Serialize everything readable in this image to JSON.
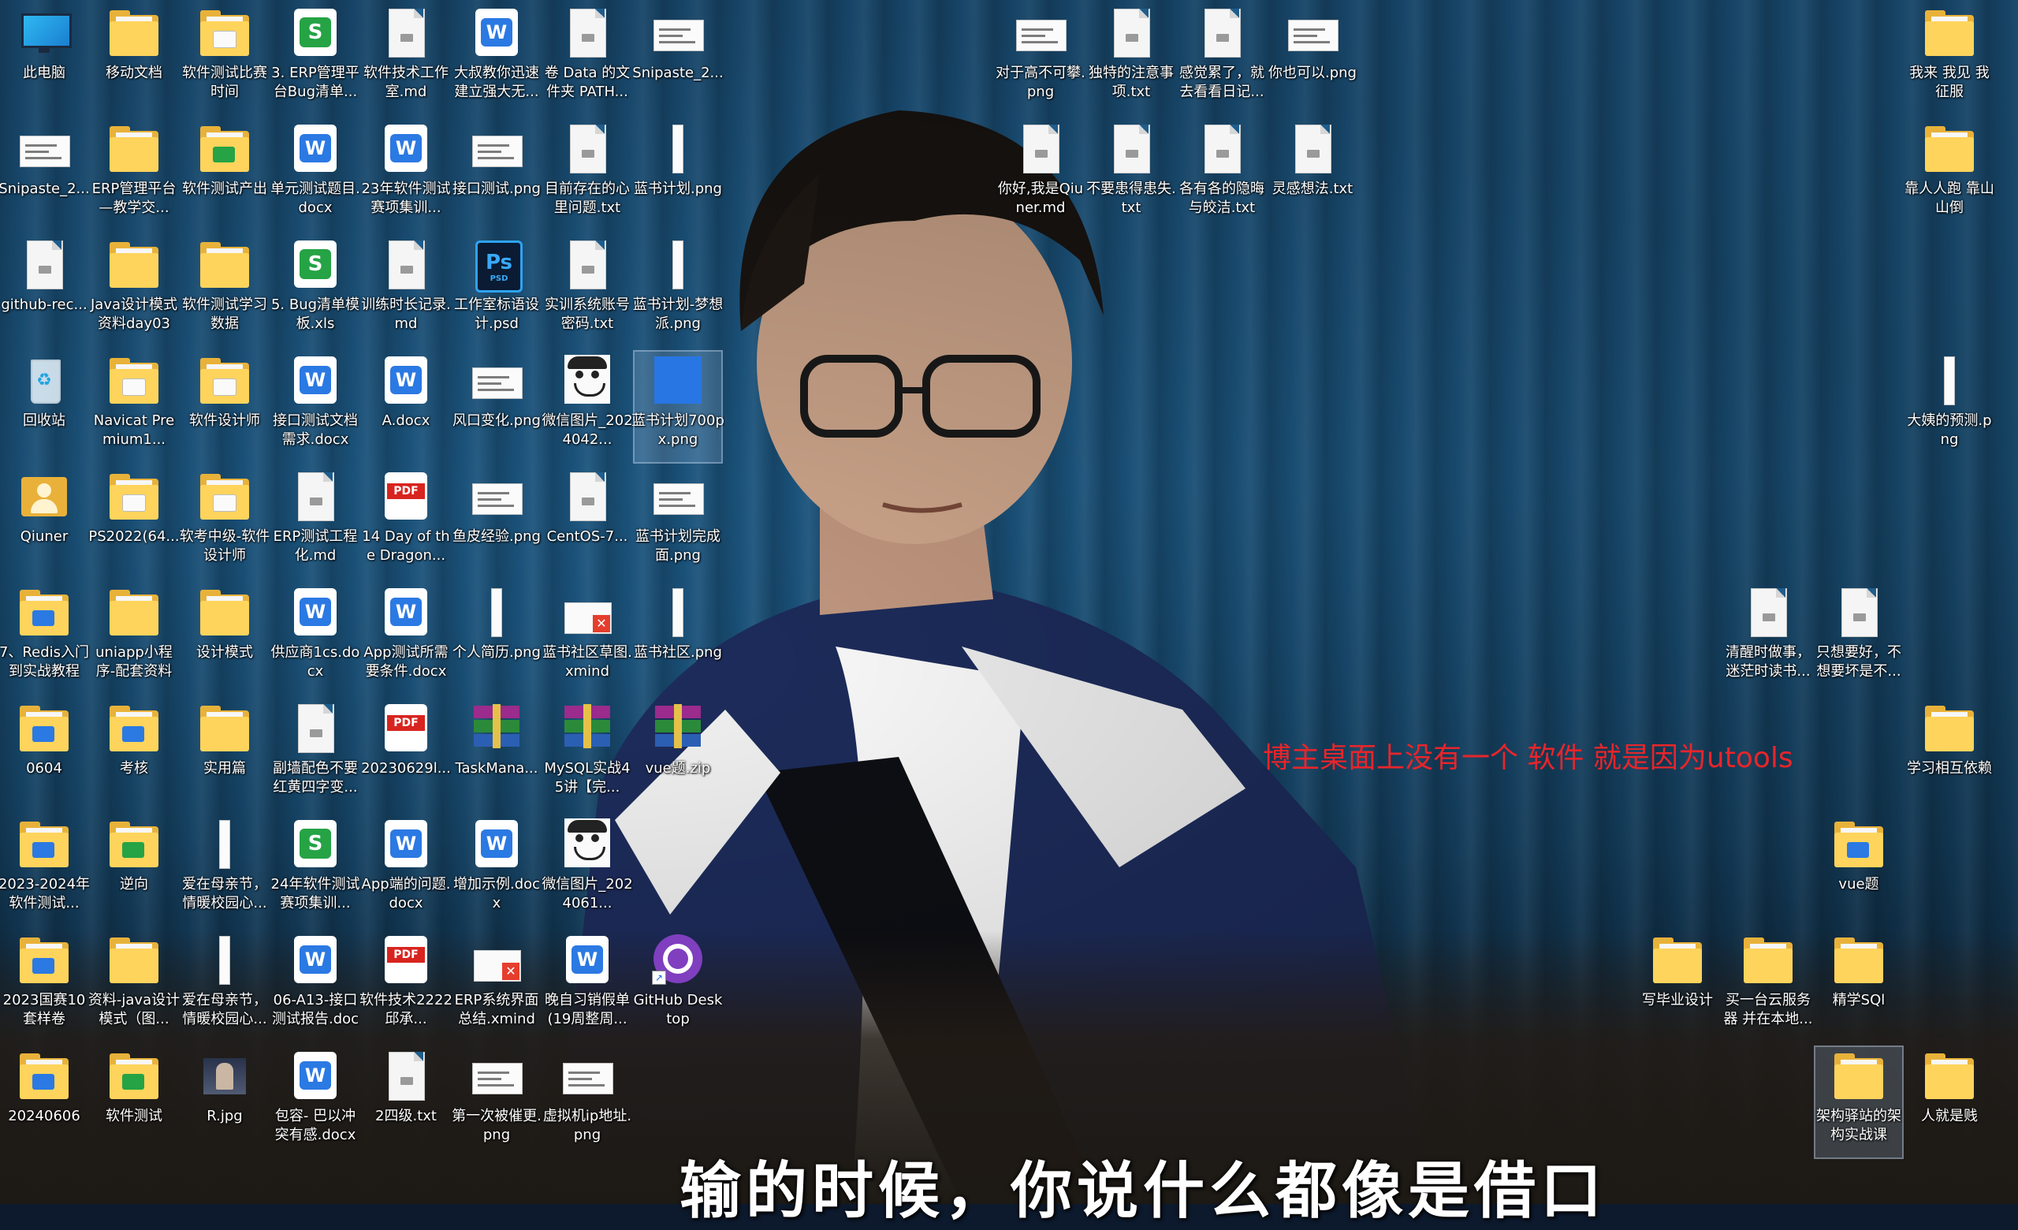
{
  "screen": {
    "type": "desktop",
    "subtitle": "输的时候，你说什么都像是借口",
    "annotation": "博主桌面上没有一个 软件 就是因为utools",
    "colors": {
      "annotation": "#e8252a",
      "folder": "#ffd45c",
      "word": "#2b79e3",
      "excel": "#25a345",
      "pdf": "#d8241f"
    }
  },
  "icons": [
    {
      "label": "此电脑",
      "kind": "pc"
    },
    {
      "label": "移动文档",
      "kind": "folder"
    },
    {
      "label": "软件测试比赛时间",
      "kind": "folder-doc"
    },
    {
      "label": "3. ERP管理平台Bug清单...",
      "kind": "excel"
    },
    {
      "label": "软件技术工作室.md",
      "kind": "doc"
    },
    {
      "label": "大叔教你迅速建立强大无...",
      "kind": "word"
    },
    {
      "label": "卷 Data 的文件夹 PATH...",
      "kind": "doc"
    },
    {
      "label": "Snipaste_2...",
      "kind": "img-wide"
    },
    {
      "label": "Snipaste_2...",
      "kind": "img-wide"
    },
    {
      "label": "ERP管理平台—教学交...",
      "kind": "folder"
    },
    {
      "label": "软件测试产出",
      "kind": "folder-green"
    },
    {
      "label": "单元测试题目.docx",
      "kind": "word"
    },
    {
      "label": "23年软件测试赛项集训...",
      "kind": "word"
    },
    {
      "label": "接口测试.png",
      "kind": "img-wide"
    },
    {
      "label": "目前存在的心里问题.txt",
      "kind": "doc"
    },
    {
      "label": "蓝书计划.png",
      "kind": "img-tall"
    },
    {
      "label": "github-rec...",
      "kind": "doc"
    },
    {
      "label": "Java设计模式资料day03",
      "kind": "folder"
    },
    {
      "label": "软件测试学习数据",
      "kind": "folder"
    },
    {
      "label": "5. Bug清单模板.xls",
      "kind": "excel"
    },
    {
      "label": "训练时长记录.md",
      "kind": "doc"
    },
    {
      "label": "工作室标语设计.psd",
      "kind": "ps"
    },
    {
      "label": "实训系统账号密码.txt",
      "kind": "doc"
    },
    {
      "label": "蓝书计划-梦想派.png",
      "kind": "img-tall"
    },
    {
      "label": "回收站",
      "kind": "recycle"
    },
    {
      "label": "Navicat Premium1...",
      "kind": "folder-doc"
    },
    {
      "label": "软件设计师",
      "kind": "folder-doc"
    },
    {
      "label": "接口测试文档需求.docx",
      "kind": "word"
    },
    {
      "label": "A.docx",
      "kind": "word"
    },
    {
      "label": "风口变化.png",
      "kind": "img-wide"
    },
    {
      "label": "微信图片_2024042...",
      "kind": "face"
    },
    {
      "label": "蓝书计划700px.png",
      "kind": "img-blue"
    },
    {
      "label": "Qiuner",
      "kind": "user"
    },
    {
      "label": "PS2022(64...",
      "kind": "folder-doc"
    },
    {
      "label": "软考中级-软件设计师",
      "kind": "folder-doc"
    },
    {
      "label": "ERP测试工程化.md",
      "kind": "doc"
    },
    {
      "label": "14 Day of the Dragon...",
      "kind": "pdf"
    },
    {
      "label": "鱼皮经验.png",
      "kind": "img-wide"
    },
    {
      "label": "CentOS-7...",
      "kind": "doc"
    },
    {
      "label": "蓝书计划完成面.png",
      "kind": "img-wide"
    },
    {
      "label": "7、Redis入门到实战教程",
      "kind": "folder-blue"
    },
    {
      "label": "uniapp小程序-配套资料",
      "kind": "folder"
    },
    {
      "label": "设计模式",
      "kind": "folder"
    },
    {
      "label": "供应商1cs.docx",
      "kind": "word"
    },
    {
      "label": "App测试所需要条件.docx",
      "kind": "word"
    },
    {
      "label": "个人简历.png",
      "kind": "img-tall"
    },
    {
      "label": "蓝书社区草图.xmind",
      "kind": "xmind"
    },
    {
      "label": "蓝书社区.png",
      "kind": "img-tall"
    },
    {
      "label": "0604",
      "kind": "folder-blue"
    },
    {
      "label": "考核",
      "kind": "folder-blue"
    },
    {
      "label": "实用篇",
      "kind": "folder"
    },
    {
      "label": "副墙配色不要红黄四字变...",
      "kind": "doc"
    },
    {
      "label": "20230629l...",
      "kind": "pdf"
    },
    {
      "label": "TaskMana...",
      "kind": "zip"
    },
    {
      "label": "MySQL实战45讲【完...",
      "kind": "zip"
    },
    {
      "label": "vue题.zip",
      "kind": "zip"
    },
    {
      "label": "2023-2024年软件测试...",
      "kind": "folder-blue"
    },
    {
      "label": "逆向",
      "kind": "folder-green"
    },
    {
      "label": "爱在母亲节，情暖校园心...",
      "kind": "img-tall"
    },
    {
      "label": "24年软件测试赛项集训...",
      "kind": "excel"
    },
    {
      "label": "App端的问题.docx",
      "kind": "word"
    },
    {
      "label": "增加示例.docx",
      "kind": "word"
    },
    {
      "label": "微信图片_2024061...",
      "kind": "face"
    },
    {
      "label": "2023国赛10套样卷",
      "kind": "folder-blue"
    },
    {
      "label": "资料-java设计模式（图...",
      "kind": "folder"
    },
    {
      "label": "爱在母亲节，情暖校园心...",
      "kind": "img-tall"
    },
    {
      "label": "06-A13-接口测试报告.doc",
      "kind": "word"
    },
    {
      "label": "软件技术2222 邱承...",
      "kind": "pdf"
    },
    {
      "label": "ERP系统界面总结.xmind",
      "kind": "xmind"
    },
    {
      "label": "晚自习销假单(19周整周...",
      "kind": "word"
    },
    {
      "label": "GitHub Desktop",
      "kind": "github"
    },
    {
      "label": "20240606",
      "kind": "folder-blue"
    },
    {
      "label": "软件测试",
      "kind": "folder-green"
    },
    {
      "label": "R.jpg",
      "kind": "rjpg"
    },
    {
      "label": "包容- 巴以冲突有感.docx",
      "kind": "word"
    },
    {
      "label": "2四级.txt",
      "kind": "doc"
    },
    {
      "label": "第一次被催更.png",
      "kind": "img-wide"
    },
    {
      "label": "虚拟机ip地址.png",
      "kind": "img-wide"
    },
    {
      "label": "对于高不可攀.png",
      "kind": "img-wide"
    },
    {
      "label": "独特的注意事项.txt",
      "kind": "doc"
    },
    {
      "label": "感觉累了，就去看看日记...",
      "kind": "doc"
    },
    {
      "label": "你也可以.png",
      "kind": "img-wide"
    },
    {
      "label": "你好,我是Qiuner.md",
      "kind": "doc"
    },
    {
      "label": "不要患得患失.txt",
      "kind": "doc"
    },
    {
      "label": "各有各的隐晦与皎洁.txt",
      "kind": "doc"
    },
    {
      "label": "灵感想法.txt",
      "kind": "doc"
    },
    {
      "label": "我来 我见 我征服",
      "kind": "folder"
    },
    {
      "label": "靠人人跑 靠山山倒",
      "kind": "folder"
    },
    {
      "label": "大姨的预测.png",
      "kind": "img-tall"
    },
    {
      "label": "学习相互依赖",
      "kind": "folder"
    },
    {
      "label": "清醒时做事，迷茫时读书...",
      "kind": "doc"
    },
    {
      "label": "只想要好，不想要坏是不...",
      "kind": "doc"
    },
    {
      "label": "vue题",
      "kind": "folder-blue"
    },
    {
      "label": "写毕业设计",
      "kind": "folder"
    },
    {
      "label": "买一台云服务器 并在本地...",
      "kind": "folder"
    },
    {
      "label": "精学SQl",
      "kind": "folder"
    },
    {
      "label": "架构驿站的架构实战课",
      "kind": "folder"
    },
    {
      "label": "人就是贱",
      "kind": "folder"
    }
  ]
}
